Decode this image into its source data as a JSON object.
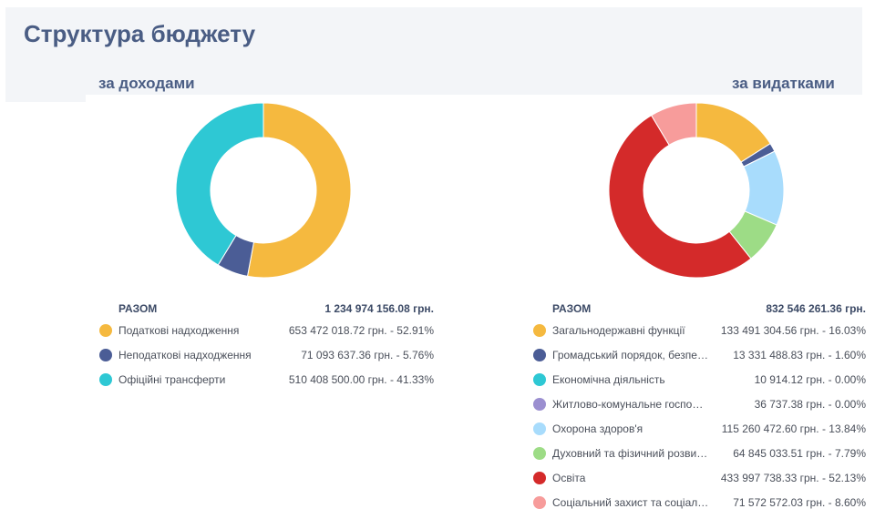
{
  "page": {
    "title": "Структура бюджету"
  },
  "chart_data": [
    {
      "type": "pie",
      "title": "за доходами",
      "total_label": "РАЗОМ",
      "total_value": "1 234 974 156.08 грн.",
      "slices": [
        {
          "name": "Податкові надходження",
          "value": 653472018.72,
          "display": "653 472 018.72 грн. - 52.91%",
          "color": "#f5b93f"
        },
        {
          "name": "Неподаткові надходження",
          "value": 71093637.36,
          "display": "71 093 637.36 грн. -  5.76%",
          "color": "#4b5d96"
        },
        {
          "name": "Офіційні трансферти",
          "value": 510408500.0,
          "display": "510 408 500.00 грн. - 41.33%",
          "color": "#2ec8d4"
        }
      ]
    },
    {
      "type": "pie",
      "title": "за видатками",
      "total_label": "РАЗОМ",
      "total_value": "832 546 261.36 грн.",
      "slices": [
        {
          "name": "Загальнодержавні функції",
          "value": 133491304.56,
          "display": "133 491 304.56 грн. - 16.03%",
          "color": "#f5b93f"
        },
        {
          "name": "Громадський порядок, безпе…",
          "value": 13331488.83,
          "display": "13 331 488.83 грн. -  1.60%",
          "color": "#4b5d96"
        },
        {
          "name": "Економічна діяльність",
          "value": 10914.12,
          "display": "10 914.12 грн. -  0.00%",
          "color": "#2ec8d4"
        },
        {
          "name": "Житлово-комунальне госпо…",
          "value": 36737.38,
          "display": "36 737.38 грн. -  0.00%",
          "color": "#9b8fd0"
        },
        {
          "name": "Охорона здоров'я",
          "value": 115260472.6,
          "display": "115 260 472.60 грн. - 13.84%",
          "color": "#a8dcfc"
        },
        {
          "name": "Духовний та фізичний розви…",
          "value": 64845033.51,
          "display": "64 845 033.51 грн. -  7.79%",
          "color": "#9ddc86"
        },
        {
          "name": "Освіта",
          "value": 433997738.33,
          "display": "433 997 738.33 грн. - 52.13%",
          "color": "#d42a2a"
        },
        {
          "name": "Соціальний захист та соціал…",
          "value": 71572572.03,
          "display": "71 572 572.03 грн. -  8.60%",
          "color": "#f79c9b"
        }
      ]
    }
  ]
}
